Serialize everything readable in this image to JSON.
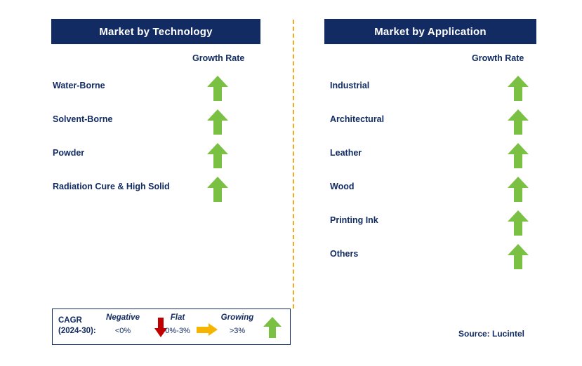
{
  "panels": [
    {
      "title": "Market by Technology",
      "growth_label": "Growth Rate",
      "rows": [
        {
          "label": "Water-Borne",
          "trend": "growing"
        },
        {
          "label": " Solvent-Borne",
          "trend": "growing"
        },
        {
          "label": "Powder",
          "trend": "growing"
        },
        {
          "label": "Radiation Cure & High Solid",
          "trend": "growing"
        }
      ]
    },
    {
      "title": "Market by Application",
      "growth_label": "Growth Rate",
      "rows": [
        {
          "label": "Industrial",
          "trend": "growing"
        },
        {
          "label": "Architectural",
          "trend": "growing"
        },
        {
          "label": "Leather",
          "trend": "growing"
        },
        {
          "label": "Wood",
          "trend": "growing"
        },
        {
          "label": "Printing Ink",
          "trend": "growing"
        },
        {
          "label": "Others",
          "trend": "growing"
        }
      ]
    }
  ],
  "legend": {
    "cagr_line1": "CAGR",
    "cagr_line2": "(2024-30):",
    "items": [
      {
        "title": "Negative",
        "range": "<0%"
      },
      {
        "title": "Flat",
        "range": "0%-3%"
      },
      {
        "title": "Growing",
        "range": ">3%"
      }
    ]
  },
  "source": "Source: Lucintel",
  "colors": {
    "header_bg": "#122b63",
    "text_navy": "#122b63",
    "arrow_green": "#7ac143",
    "arrow_red": "#c00000",
    "arrow_yellow": "#f5b400",
    "divider_orange": "#f5a623"
  }
}
